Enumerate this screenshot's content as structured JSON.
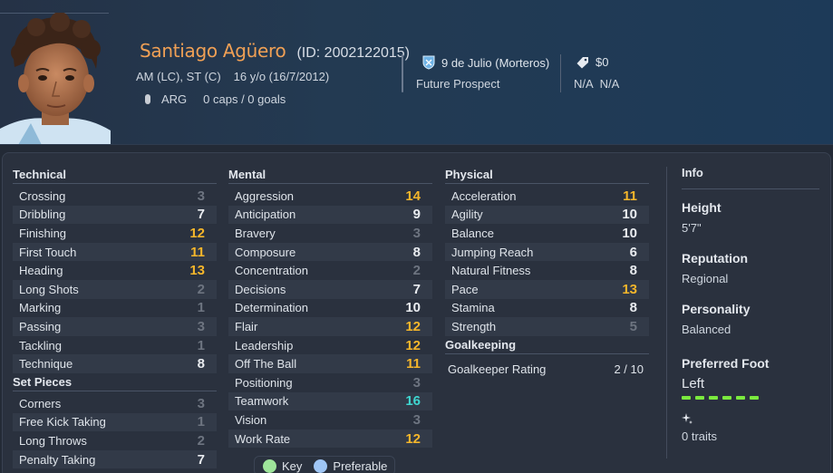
{
  "player": {
    "name": "Santiago Agüero",
    "id_text": "(ID: 2002122015)",
    "positions": "AM (LC), ST (C)",
    "age_dob": "16 y/o (16/7/2012)",
    "nationality": "ARG",
    "caps_goals": "0 caps / 0 goals"
  },
  "club": {
    "name": "9 de Julio (Morteros)",
    "status": "Future Prospect"
  },
  "contract": {
    "value": "$0",
    "na1": "N/A",
    "na2": "N/A"
  },
  "sections": {
    "technical": "Technical",
    "set_pieces": "Set Pieces",
    "mental": "Mental",
    "physical": "Physical",
    "goalkeeping": "Goalkeeping"
  },
  "technical": [
    {
      "label": "Crossing",
      "value": "3"
    },
    {
      "label": "Dribbling",
      "value": "7"
    },
    {
      "label": "Finishing",
      "value": "12"
    },
    {
      "label": "First Touch",
      "value": "11"
    },
    {
      "label": "Heading",
      "value": "13"
    },
    {
      "label": "Long Shots",
      "value": "2"
    },
    {
      "label": "Marking",
      "value": "1"
    },
    {
      "label": "Passing",
      "value": "3"
    },
    {
      "label": "Tackling",
      "value": "1"
    },
    {
      "label": "Technique",
      "value": "8"
    }
  ],
  "set_pieces": [
    {
      "label": "Corners",
      "value": "3"
    },
    {
      "label": "Free Kick Taking",
      "value": "1"
    },
    {
      "label": "Long Throws",
      "value": "2"
    },
    {
      "label": "Penalty Taking",
      "value": "7"
    }
  ],
  "mental": [
    {
      "label": "Aggression",
      "value": "14"
    },
    {
      "label": "Anticipation",
      "value": "9"
    },
    {
      "label": "Bravery",
      "value": "3"
    },
    {
      "label": "Composure",
      "value": "8"
    },
    {
      "label": "Concentration",
      "value": "2"
    },
    {
      "label": "Decisions",
      "value": "7"
    },
    {
      "label": "Determination",
      "value": "10"
    },
    {
      "label": "Flair",
      "value": "12"
    },
    {
      "label": "Leadership",
      "value": "12"
    },
    {
      "label": "Off The Ball",
      "value": "11"
    },
    {
      "label": "Positioning",
      "value": "3"
    },
    {
      "label": "Teamwork",
      "value": "16"
    },
    {
      "label": "Vision",
      "value": "3"
    },
    {
      "label": "Work Rate",
      "value": "12"
    }
  ],
  "physical": [
    {
      "label": "Acceleration",
      "value": "11"
    },
    {
      "label": "Agility",
      "value": "10"
    },
    {
      "label": "Balance",
      "value": "10"
    },
    {
      "label": "Jumping Reach",
      "value": "6"
    },
    {
      "label": "Natural Fitness",
      "value": "8"
    },
    {
      "label": "Pace",
      "value": "13"
    },
    {
      "label": "Stamina",
      "value": "8"
    },
    {
      "label": "Strength",
      "value": "5"
    }
  ],
  "goalkeeping": {
    "label": "Goalkeeper Rating",
    "value": "2 / 10"
  },
  "legend": {
    "key": "Key",
    "preferable": "Preferable"
  },
  "info": {
    "title": "Info",
    "height_label": "Height",
    "height_value": "5'7\"",
    "reputation_label": "Reputation",
    "reputation_value": "Regional",
    "personality_label": "Personality",
    "personality_value": "Balanced",
    "foot_label": "Preferred Foot",
    "foot_value": "Left",
    "traits": "0 traits"
  },
  "colors": {
    "name": "#f0a055",
    "value_good": "#f5b62b",
    "value_great": "#3fd6d0",
    "value_low": "#6d7480",
    "foot_bar": "#7bea3e"
  },
  "icons": [
    "club-crest-icon",
    "price-tag-icon",
    "flag-icon",
    "sparkle-icon"
  ]
}
